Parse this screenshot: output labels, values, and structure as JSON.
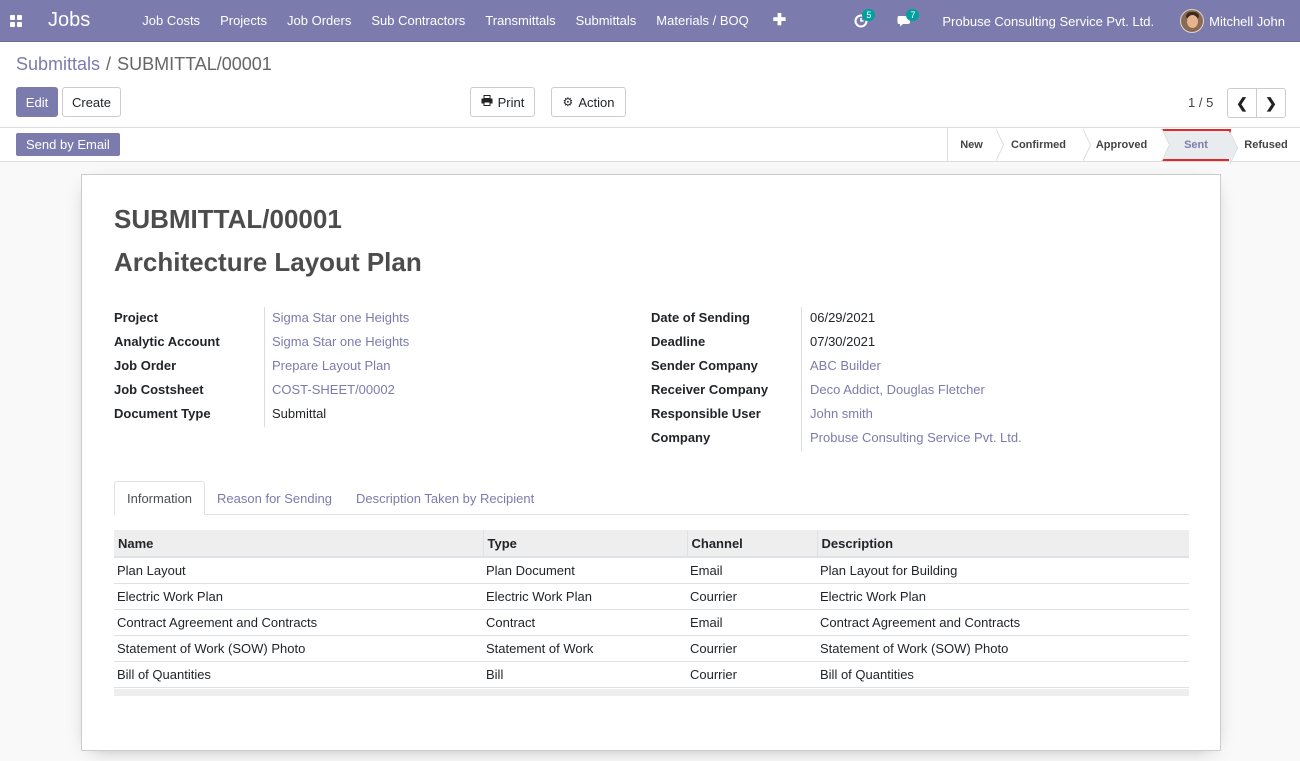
{
  "navbar": {
    "brand": "Jobs",
    "menu": [
      "Job Costs",
      "Projects",
      "Job Orders",
      "Sub Contractors",
      "Transmittals",
      "Submittals",
      "Materials / BOQ"
    ],
    "plus": "✚",
    "activity_count": "5",
    "messages_count": "7",
    "company": "Probuse Consulting Service Pvt. Ltd.",
    "user": "Mitchell John",
    "color": "#7C7BAD"
  },
  "breadcrumb": {
    "parent": "Submittals",
    "separator": "/",
    "current": "SUBMITTAL/00001"
  },
  "buttons": {
    "edit": "Edit",
    "create": "Create",
    "print": "Print",
    "action": "Action",
    "send_email": "Send by Email"
  },
  "pager": {
    "value": "1 / 5",
    "prev": "❮",
    "next": "❯"
  },
  "status": {
    "stages": [
      "New",
      "Confirmed",
      "Approved",
      "Sent",
      "Refused"
    ],
    "current": "Sent"
  },
  "record": {
    "number": "SUBMITTAL/00001",
    "title": "Architecture Layout Plan",
    "left_fields": [
      {
        "label": "Project",
        "value": "Sigma Star one Heights",
        "link": true
      },
      {
        "label": "Analytic Account",
        "value": "Sigma Star one Heights",
        "link": true
      },
      {
        "label": "Job Order",
        "value": "Prepare Layout Plan",
        "link": true
      },
      {
        "label": "Job Costsheet",
        "value": "COST-SHEET/00002",
        "link": true
      },
      {
        "label": "Document Type",
        "value": "Submittal",
        "link": false
      }
    ],
    "right_fields": [
      {
        "label": "Date of Sending",
        "value": "06/29/2021",
        "link": false
      },
      {
        "label": "Deadline",
        "value": "07/30/2021",
        "link": false
      },
      {
        "label": "Sender Company",
        "value": "ABC Builder",
        "link": true
      },
      {
        "label": "Receiver Company",
        "value": "Deco Addict, Douglas Fletcher",
        "link": true
      },
      {
        "label": "Responsible User",
        "value": "John smith",
        "link": true
      },
      {
        "label": "Company",
        "value": "Probuse Consulting Service Pvt. Ltd.",
        "link": true
      }
    ]
  },
  "tabs": [
    "Information",
    "Reason for Sending",
    "Description Taken by Recipient"
  ],
  "table": {
    "columns": [
      "Name",
      "Type",
      "Channel",
      "Description"
    ],
    "rows": [
      [
        "Plan Layout",
        "Plan Document",
        "Email",
        "Plan Layout for Building"
      ],
      [
        "Electric Work Plan",
        "Electric Work Plan",
        "Courrier",
        "Electric Work Plan"
      ],
      [
        "Contract Agreement and Contracts",
        "Contract",
        "Email",
        "Contract Agreement and Contracts"
      ],
      [
        "Statement of Work (SOW) Photo",
        "Statement of Work",
        "Courrier",
        "Statement of Work (SOW) Photo"
      ],
      [
        "Bill of Quantities",
        "Bill",
        "Courrier",
        "Bill of Quantities"
      ]
    ]
  }
}
